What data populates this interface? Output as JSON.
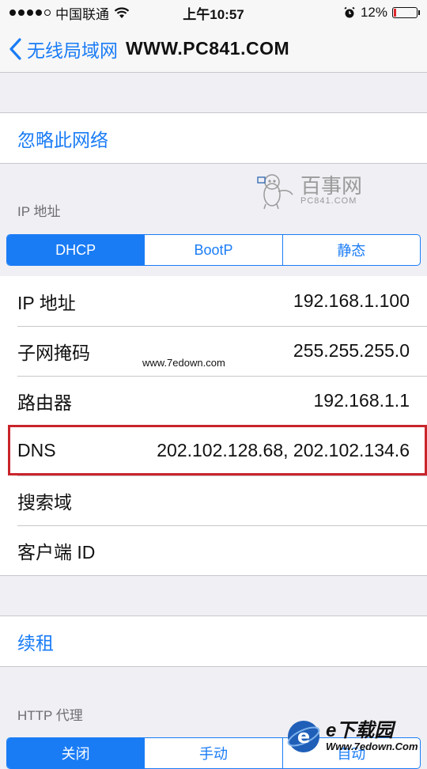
{
  "status_bar": {
    "carrier": "中国联通",
    "time": "上午10:57",
    "battery_percent": "12%",
    "battery_level": 0.12,
    "signal_bars_filled": 4,
    "signal_bars_total": 5
  },
  "nav": {
    "back_label": "无线局域网",
    "title": "WWW.PC841.COM"
  },
  "forget": {
    "label": "忽略此网络"
  },
  "ip_section": {
    "header": "IP 地址",
    "segments": [
      "DHCP",
      "BootP",
      "静态"
    ],
    "selected_segment": "DHCP",
    "rows": [
      {
        "label": "IP 地址",
        "value": "192.168.1.100"
      },
      {
        "label": "子网掩码",
        "value": "255.255.255.0"
      },
      {
        "label": "路由器",
        "value": "192.168.1.1"
      },
      {
        "label": "DNS",
        "value": "202.102.128.68, 202.102.134.6"
      },
      {
        "label": "搜索域",
        "value": ""
      },
      {
        "label": "客户端 ID",
        "value": ""
      }
    ]
  },
  "renew": {
    "label": "续租"
  },
  "http_proxy": {
    "header": "HTTP 代理",
    "segments": [
      "关闭",
      "手动",
      "自动"
    ],
    "selected_segment": "关闭"
  },
  "watermarks": {
    "site_7edown": "www.7edown.com",
    "pc841_main": "百事网",
    "pc841_sub": "PC841.COM",
    "bottom_main": "e下载园",
    "bottom_url": "Www.7edown.Com"
  },
  "colors": {
    "accent": "#1a7cf5",
    "highlight_border": "#c9242a",
    "background": "#efeff4",
    "battery_low": "#e0292e"
  }
}
